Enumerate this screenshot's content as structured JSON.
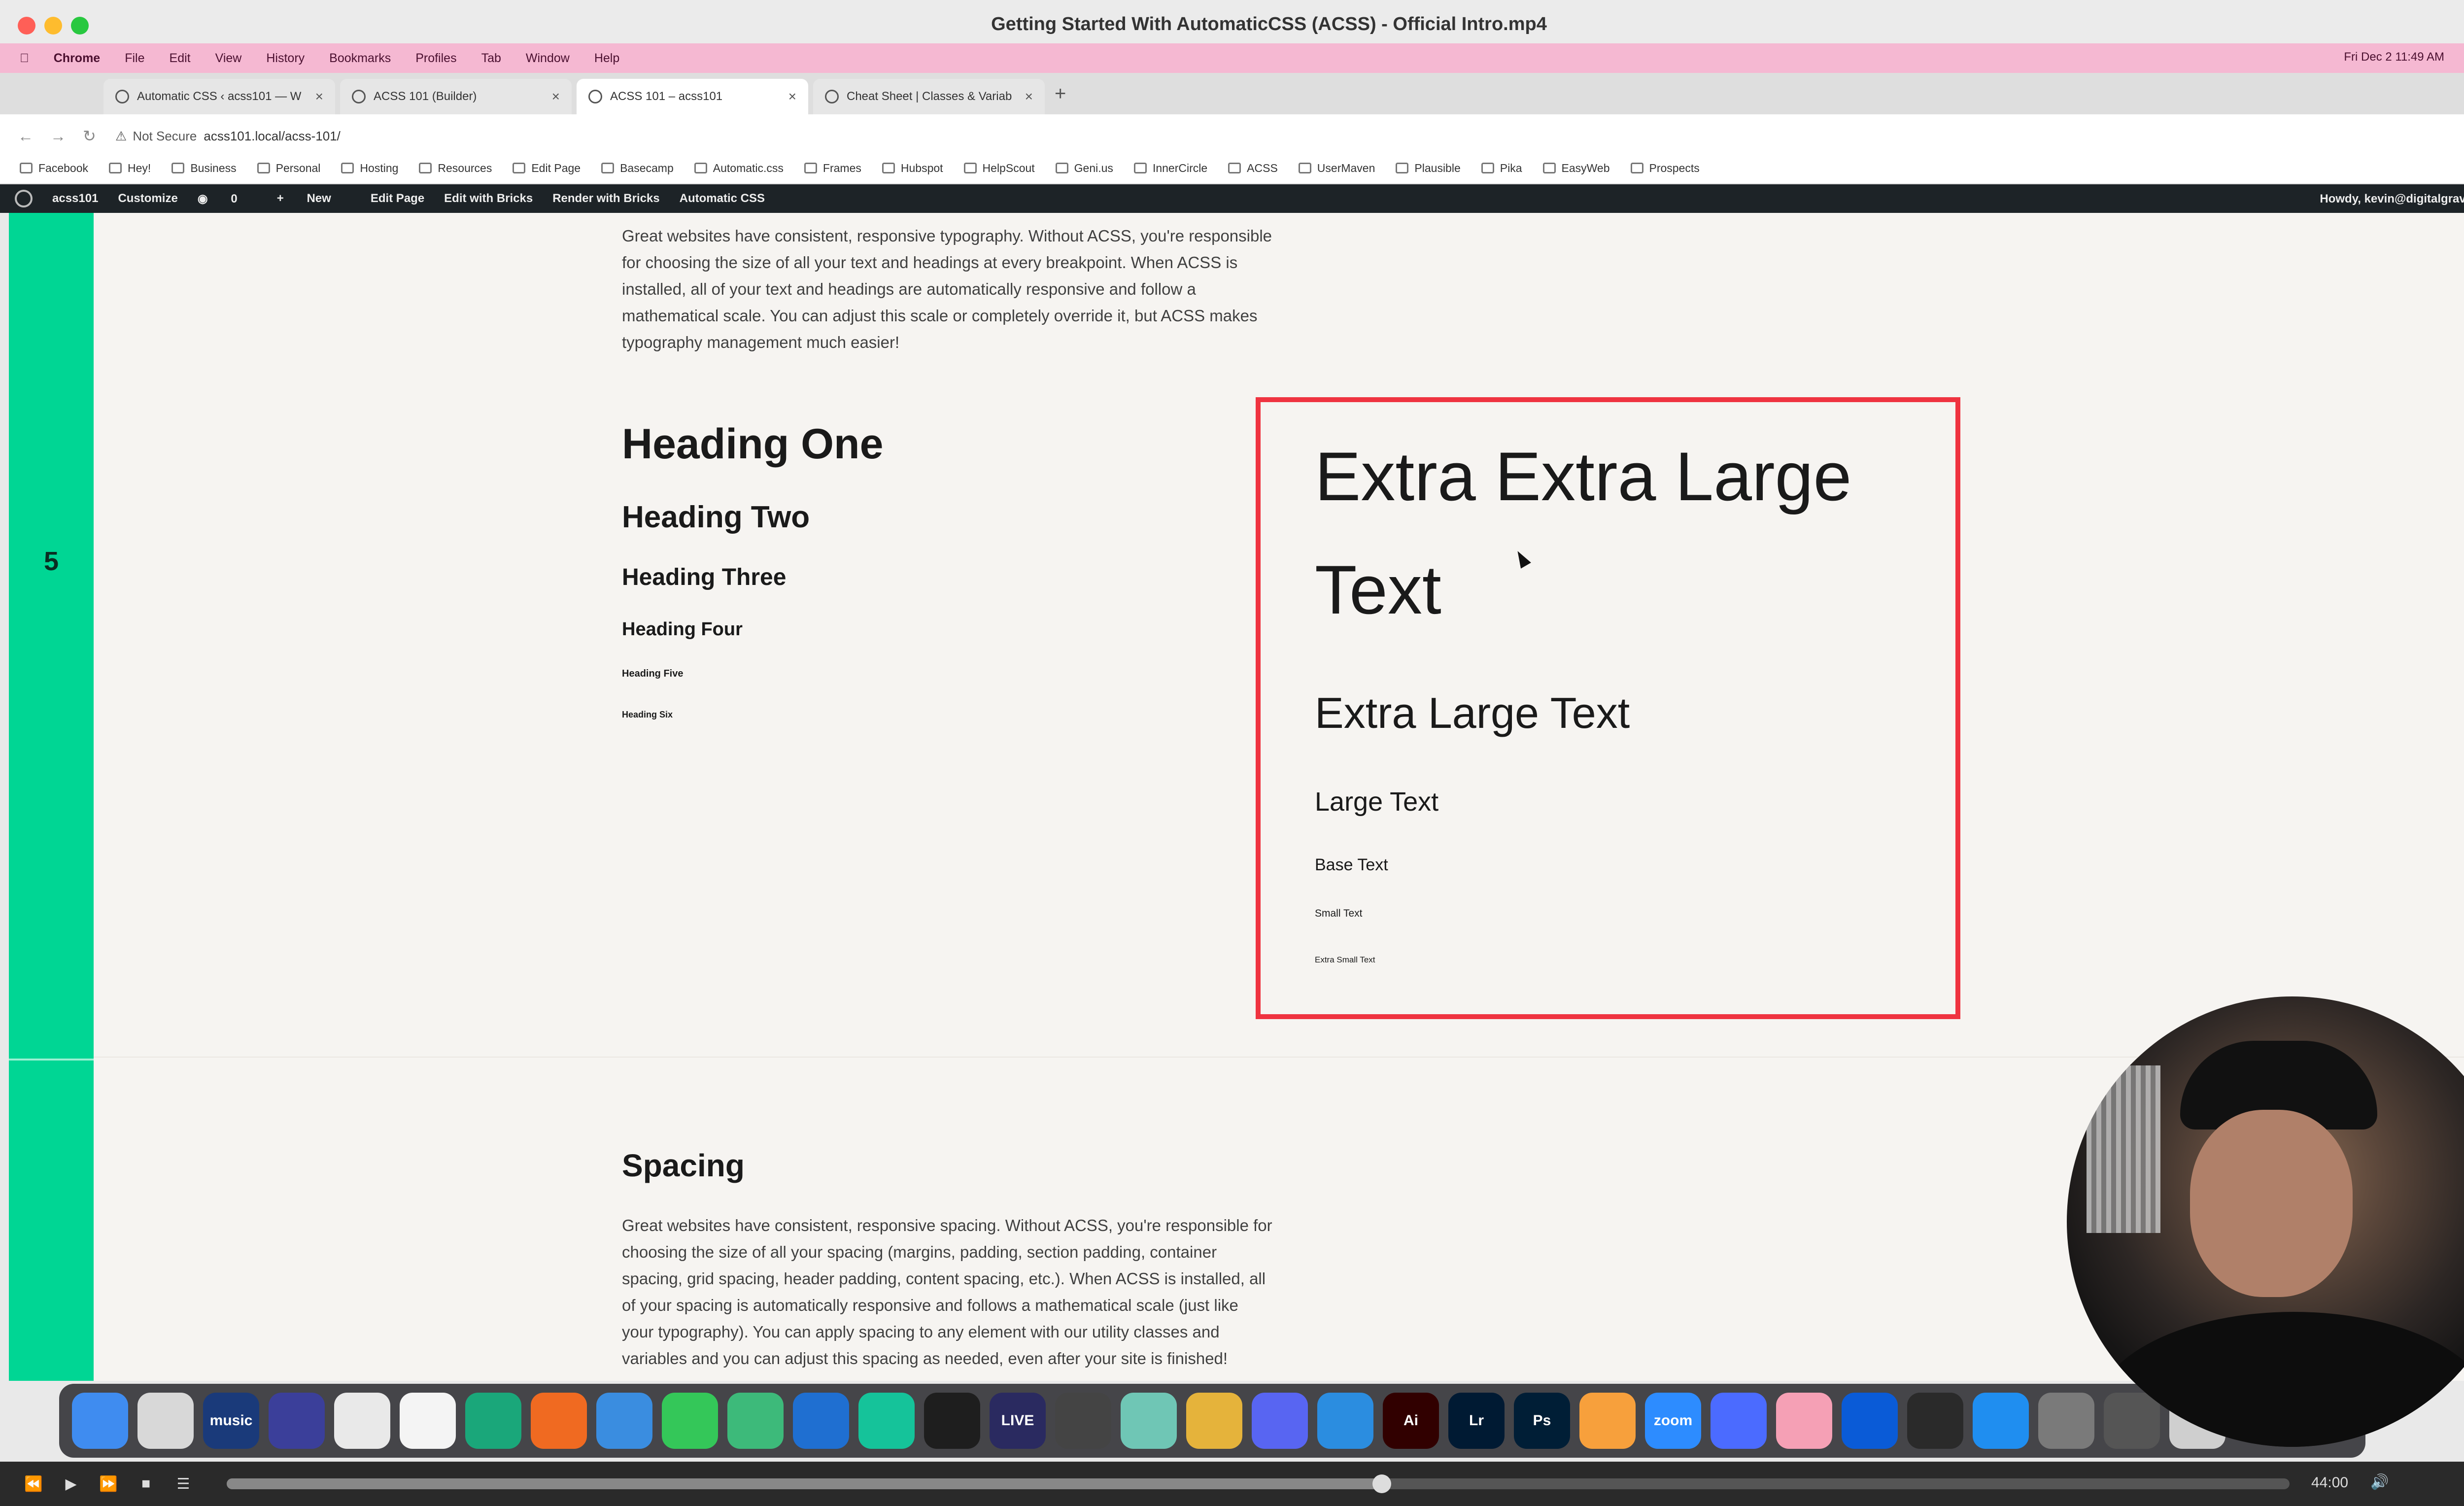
{
  "window": {
    "title": "Getting Started With AutomaticCSS (ACSS) - Official Intro.mp4"
  },
  "menubar": {
    "items": [
      "Chrome",
      "File",
      "Edit",
      "View",
      "History",
      "Bookmarks",
      "Profiles",
      "Tab",
      "Window",
      "Help"
    ],
    "clock": "Fri Dec 2  11:49 AM"
  },
  "tabs": [
    {
      "label": "Automatic CSS ‹ acss101 — W"
    },
    {
      "label": "ACSS 101 (Builder)"
    },
    {
      "label": "ACSS 101 – acss101"
    },
    {
      "label": "Cheat Sheet | Classes & Variab"
    }
  ],
  "address": {
    "security": "Not Secure",
    "url": "acss101.local/acss-101/"
  },
  "bookmarks": [
    "Facebook",
    "Hey!",
    "Business",
    "Personal",
    "Hosting",
    "Resources",
    "Edit Page",
    "Basecamp",
    "Automatic.css",
    "Frames",
    "Hubspot",
    "HelpScout",
    "Geni.us",
    "InnerCircle",
    "ACSS",
    "UserMaven",
    "Plausible",
    "Pika",
    "EasyWeb",
    "Prospects"
  ],
  "wpbar": {
    "site": "acss101",
    "customize": "Customize",
    "comments": "0",
    "new": "New",
    "edit_page": "Edit Page",
    "edit_bricks": "Edit with Bricks",
    "render_bricks": "Render with Bricks",
    "acss": "Automatic CSS",
    "howdy": "Howdy, kevin@digitalgravy.co"
  },
  "section": {
    "number": "5"
  },
  "typography": {
    "intro": [
      "Great websites have consistent, responsive typography. Without ACSS, you're responsible",
      "for choosing the size of all your text and headings at every breakpoint. When ACSS is",
      "installed, all of your text and headings are automatically responsive and follow a",
      "mathematical scale. You can adjust this scale or completely override it, but ACSS makes",
      "typography management much easier!"
    ],
    "h1": "Heading One",
    "h2": "Heading Two",
    "h3": "Heading Three",
    "h4": "Heading Four",
    "h5": "Heading Five",
    "h6": "Heading Six",
    "xxl_line1": "Extra Extra Large",
    "xxl_line2": "Text",
    "xl": "Extra Large Text",
    "l": "Large Text",
    "base": "Base Text",
    "s": "Small Text",
    "xs": "Extra Small Text"
  },
  "spacing": {
    "heading": "Spacing",
    "intro": [
      "Great websites have consistent, responsive spacing. Without ACSS, you're responsible for",
      "choosing the size of all your spacing (margins, padding, section padding, container",
      "spacing, grid spacing, header padding, content spacing, etc.). When ACSS is installed, all",
      "of your spacing is automatically responsive and follows a mathematical scale (just like",
      "your typography). You can apply spacing to any element with our utility classes and",
      "variables and you can adjust this spacing as needed, even after your site is finished!"
    ]
  },
  "dock": [
    {
      "icon": "finder-icon",
      "label": "",
      "color": "#3f8cf0"
    },
    {
      "icon": "launchpad-icon",
      "label": "",
      "color": "#d8d8d8"
    },
    {
      "icon": "amazon-music-icon",
      "label": "music",
      "color": "#1a3a7a"
    },
    {
      "icon": "hand-app-icon",
      "label": "",
      "color": "#3b3f9a"
    },
    {
      "icon": "chrome-icon",
      "label": "",
      "color": "#e9e9e9"
    },
    {
      "icon": "slack-icon",
      "label": "",
      "color": "#f4f4f4"
    },
    {
      "icon": "app-icon",
      "label": "",
      "color": "#1aa77a"
    },
    {
      "icon": "firefox-icon",
      "label": "",
      "color": "#f06a21"
    },
    {
      "icon": "safari-icon",
      "label": "",
      "color": "#3a8de0"
    },
    {
      "icon": "messages-icon",
      "label": "",
      "color": "#34c759"
    },
    {
      "icon": "app-icon",
      "label": "",
      "color": "#3dba7a"
    },
    {
      "icon": "vscode-icon",
      "label": "",
      "color": "#1f6fd1"
    },
    {
      "icon": "grammarly-icon",
      "label": "",
      "color": "#15c39a"
    },
    {
      "icon": "figma-icon",
      "label": "",
      "color": "#1e1e1e"
    },
    {
      "icon": "live-icon",
      "label": "LIVE",
      "color": "#2a2a60"
    },
    {
      "icon": "clapper-icon",
      "label": "",
      "color": "#444"
    },
    {
      "icon": "app-icon",
      "label": "",
      "color": "#6fc6b5"
    },
    {
      "icon": "forklift-icon",
      "label": "",
      "color": "#e5b33b"
    },
    {
      "icon": "discord-icon",
      "label": "",
      "color": "#5865f2"
    },
    {
      "icon": "keynote-icon",
      "label": "",
      "color": "#2b8de0"
    },
    {
      "icon": "illustrator-icon",
      "label": "Ai",
      "color": "#310000"
    },
    {
      "icon": "lightroom-icon",
      "label": "Lr",
      "color": "#001a33"
    },
    {
      "icon": "photoshop-icon",
      "label": "Ps",
      "color": "#001e36"
    },
    {
      "icon": "pages-icon",
      "label": "",
      "color": "#f7a03c"
    },
    {
      "icon": "zoom-icon",
      "label": "zoom",
      "color": "#2d8cff"
    },
    {
      "icon": "app-icon",
      "label": "",
      "color": "#4b6bff"
    },
    {
      "icon": "cleanmymac-icon",
      "label": "",
      "color": "#f5a0b5"
    },
    {
      "icon": "1password-icon",
      "label": "",
      "color": "#0a5bd7"
    },
    {
      "icon": "vectorize-icon",
      "label": "",
      "color": "#2a2a2a"
    },
    {
      "icon": "app-store-icon",
      "label": "",
      "color": "#1f8ef0"
    },
    {
      "icon": "settings-icon",
      "label": "",
      "color": "#7a7a7a"
    },
    {
      "icon": "app-icon",
      "label": "",
      "color": "#555"
    },
    {
      "icon": "trash-icon",
      "label": "",
      "color": "#cfcfcf"
    }
  ],
  "player": {
    "time": "44:00",
    "progress": 0.56
  }
}
